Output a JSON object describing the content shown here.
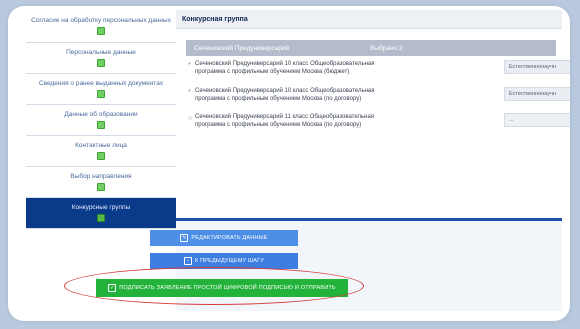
{
  "sidebar": {
    "items": [
      {
        "label": "Согласие на обработку персональных данных",
        "active": false
      },
      {
        "label": "Персональные данные",
        "active": false
      },
      {
        "label": "Сведения о ранее выданных документах",
        "active": false
      },
      {
        "label": "Данные об образовании",
        "active": false
      },
      {
        "label": "Контактные лица",
        "active": false
      },
      {
        "label": "Выбор направления",
        "active": false
      },
      {
        "label": "Конкурсные группы",
        "active": true
      }
    ]
  },
  "main": {
    "header": "Конкурсная группа",
    "group": {
      "university": "Сеченовский Предуниверсарий",
      "selected": "Выбрано:2"
    },
    "programs": [
      {
        "mark": "*",
        "line1": "Сеченовский Предуниверсарий 10 класс Общеобразовательная",
        "line2": "программа с профильным обучением Москва (бюджет)",
        "select": "Естественнонаучн"
      },
      {
        "mark": "*",
        "line1": "Сеченовский Предуниверсарий 10 класс Общеобразовательная",
        "line2": "программа с профильным обучением Москва (по договору)",
        "select": "Естественнонаучн"
      },
      {
        "mark": "○",
        "line1": "Сеченовский Предуниверсарий 11 класс Общеобразовательная",
        "line2": "программа с профильным обучением Москва (по договору)",
        "select": "..."
      }
    ]
  },
  "buttons": {
    "edit": "РЕДАКТИРОВАТЬ ДАННЫЕ",
    "prev": "К ПРЕДЫДУЩЕМУ ШАГУ",
    "sign": "ПОДПИСАТЬ ЗАЯВЛЕНИЕ ПРОСТОЙ ЦИФРОВОЙ ПОДПИСЬЮ И ОТПРАВИТЬ"
  },
  "colors": {
    "active_item": "#0a3a8a",
    "accent_blue": "#1c4fa8",
    "sign_green": "#24b33a",
    "highlight_red": "#d63b3b"
  }
}
